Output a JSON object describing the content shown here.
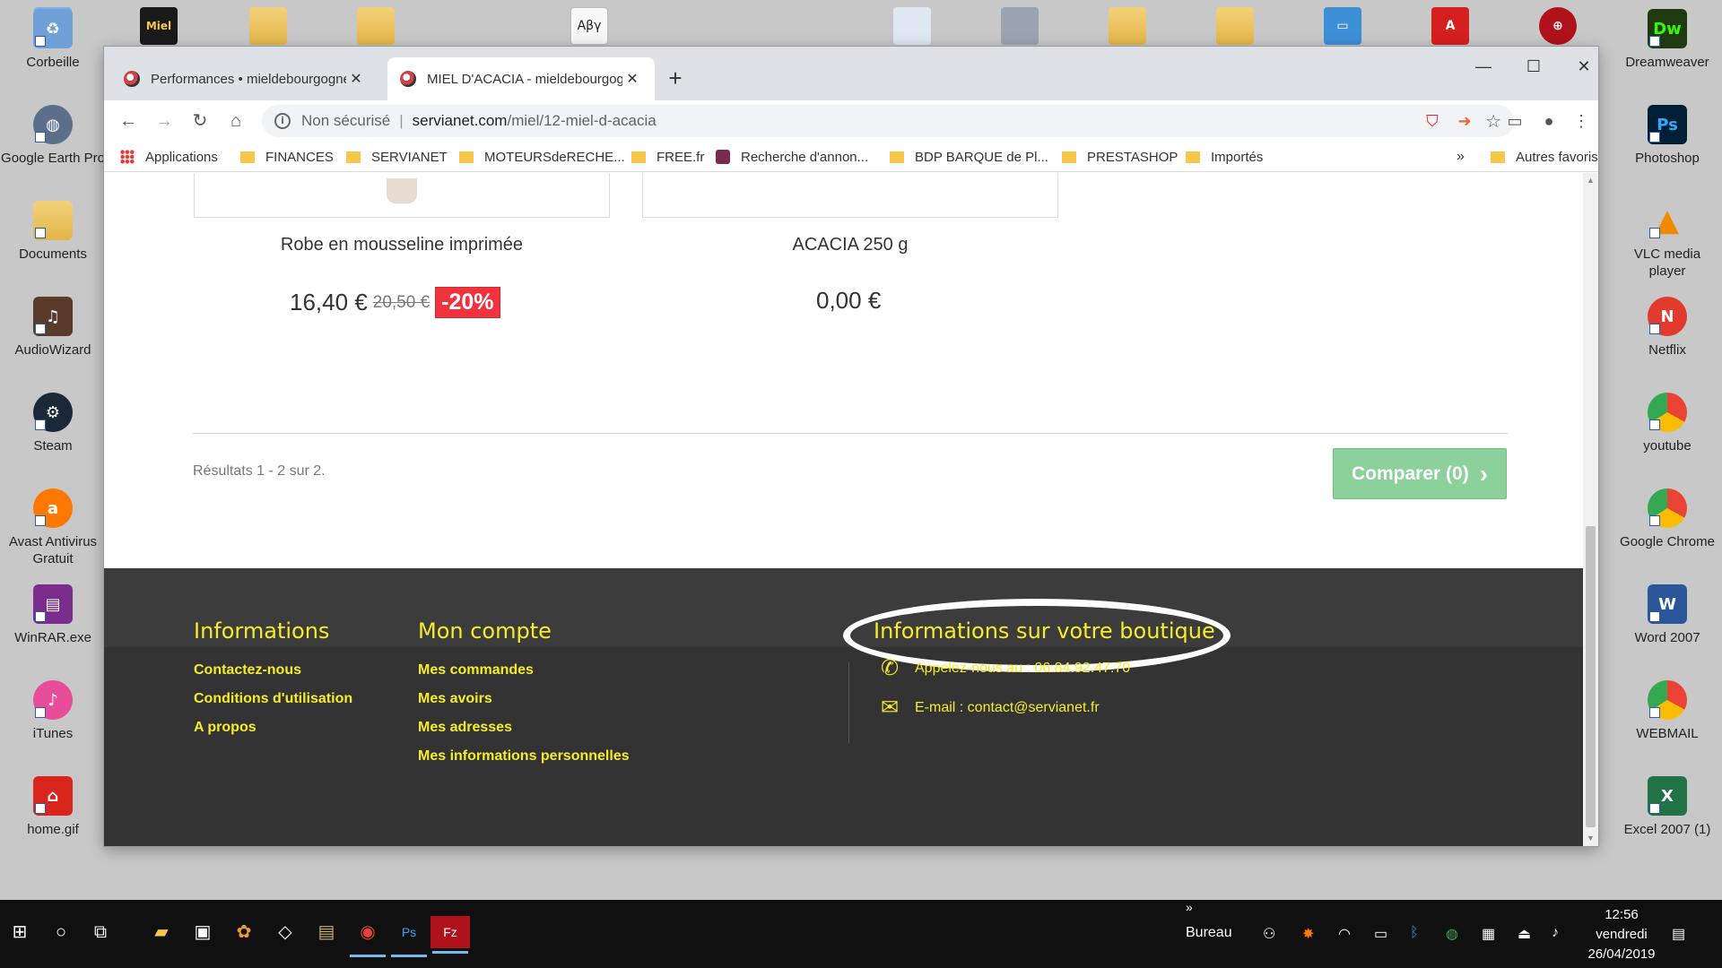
{
  "desktop": {
    "left_icons": [
      {
        "label": "Corbeille",
        "icon": "recycle-bin-icon",
        "color": "#6fa0d8"
      },
      {
        "label": "Google Earth Pro",
        "icon": "google-earth-icon",
        "color": "#5c6f8a"
      },
      {
        "label": "Documents",
        "icon": "folder-icon",
        "color": "#e3b548"
      },
      {
        "label": "AudioWizard",
        "icon": "audiowizard-icon",
        "color": "#5a3a2a"
      },
      {
        "label": "Steam",
        "icon": "steam-icon",
        "color": "#1b2838"
      },
      {
        "label": "Avast Antivirus Gratuit",
        "icon": "avast-icon",
        "color": "#ff7800"
      },
      {
        "label": "WinRAR.exe",
        "icon": "winrar-icon",
        "color": "#7b2d8b"
      },
      {
        "label": "iTunes",
        "icon": "itunes-icon",
        "color": "#e84d9a"
      },
      {
        "label": "home.gif",
        "icon": "home-icon",
        "color": "#d9261c"
      }
    ],
    "right_icons": [
      {
        "label": "Dreamweaver",
        "icon": "dreamweaver-icon",
        "color": "#35fa00",
        "glyph": "Dw"
      },
      {
        "label": "Photoshop",
        "icon": "photoshop-icon",
        "color": "#001e36",
        "glyph": "Ps"
      },
      {
        "label": "VLC media player",
        "icon": "vlc-icon",
        "color": "#f08a00",
        "glyph": "▲"
      },
      {
        "label": "Netflix",
        "icon": "netflix-icon",
        "color": "#e23a2c",
        "glyph": "N"
      },
      {
        "label": "youtube",
        "icon": "chrome-icon",
        "color": "#4285f4",
        "glyph": "◉"
      },
      {
        "label": "Google Chrome",
        "icon": "chrome-icon",
        "color": "#4285f4",
        "glyph": "◉"
      },
      {
        "label": "Word 2007",
        "icon": "word-icon",
        "color": "#2b579a",
        "glyph": "W"
      },
      {
        "label": "WEBMAIL",
        "icon": "chrome-icon",
        "color": "#4285f4",
        "glyph": "◉"
      },
      {
        "label": "Excel 2007 (1)",
        "icon": "excel-icon",
        "color": "#217346",
        "glyph": "X"
      }
    ],
    "top_glyph": "Αβγ",
    "top_miel_label": "Miel"
  },
  "browser": {
    "tabs": [
      {
        "title": "Performances • mieldebourgogne",
        "close": "✕"
      },
      {
        "title": "MIEL D'ACACIA - mieldebourgogne",
        "close": "✕"
      }
    ],
    "new_tab": "+",
    "window_controls": {
      "minimize": "—",
      "maximize": "☐",
      "close": "✕"
    },
    "nav": {
      "back": "←",
      "forward": "→",
      "reload": "↻",
      "home": "⌂"
    },
    "address": {
      "security_label": "Non sécurisé",
      "separator": "|",
      "host": "servianet.com",
      "path": "/miel/12-miel-d-acacia",
      "star": "☆"
    },
    "bookmarks": [
      {
        "label": "Applications",
        "kind": "grid"
      },
      {
        "label": "FINANCES",
        "kind": "folder"
      },
      {
        "label": "SERVIANET",
        "kind": "folder"
      },
      {
        "label": "MOTEURSdeRECHE...",
        "kind": "folder"
      },
      {
        "label": "FREE.fr",
        "kind": "folder"
      },
      {
        "label": "Recherche d'annon...",
        "kind": "shirt"
      },
      {
        "label": "BDP BARQUE de Pl...",
        "kind": "folder"
      },
      {
        "label": "PRESTASHOP",
        "kind": "folder"
      },
      {
        "label": "Importés",
        "kind": "folder"
      }
    ],
    "bookmarks_more": "»",
    "other_bookmarks": "Autres favoris"
  },
  "page": {
    "products": [
      {
        "name": "Robe en mousseline imprimée",
        "price": "16,40 €",
        "old_price": "20,50 €",
        "discount": "-20%"
      },
      {
        "name": "ACACIA 250 g",
        "price": "0,00 €"
      }
    ],
    "results": "Résultats 1 - 2 sur 2.",
    "compare_label": "Comparer (0)",
    "compare_arrow": "›",
    "accent": "#f5ed2a",
    "footer": {
      "info_title": "Informations",
      "info_links": [
        "Contactez-nous",
        "Conditions d'utilisation",
        "A propos"
      ],
      "account_title": "Mon compte",
      "account_links": [
        "Mes commandes",
        "Mes avoirs",
        "Mes adresses",
        "Mes informations personnelles"
      ],
      "shop_title": "Informations sur votre boutique",
      "phone": "Appelez-nous au : 06.84.92.47.70",
      "email": "E-mail : contact@servianet.fr"
    }
  },
  "taskbar": {
    "start": "⊞",
    "search": "○",
    "taskview": "⧉",
    "desktop_label": "Bureau",
    "chevron": "»",
    "clock": {
      "time": "12:56",
      "day": "vendredi",
      "date": "26/04/2019"
    }
  }
}
